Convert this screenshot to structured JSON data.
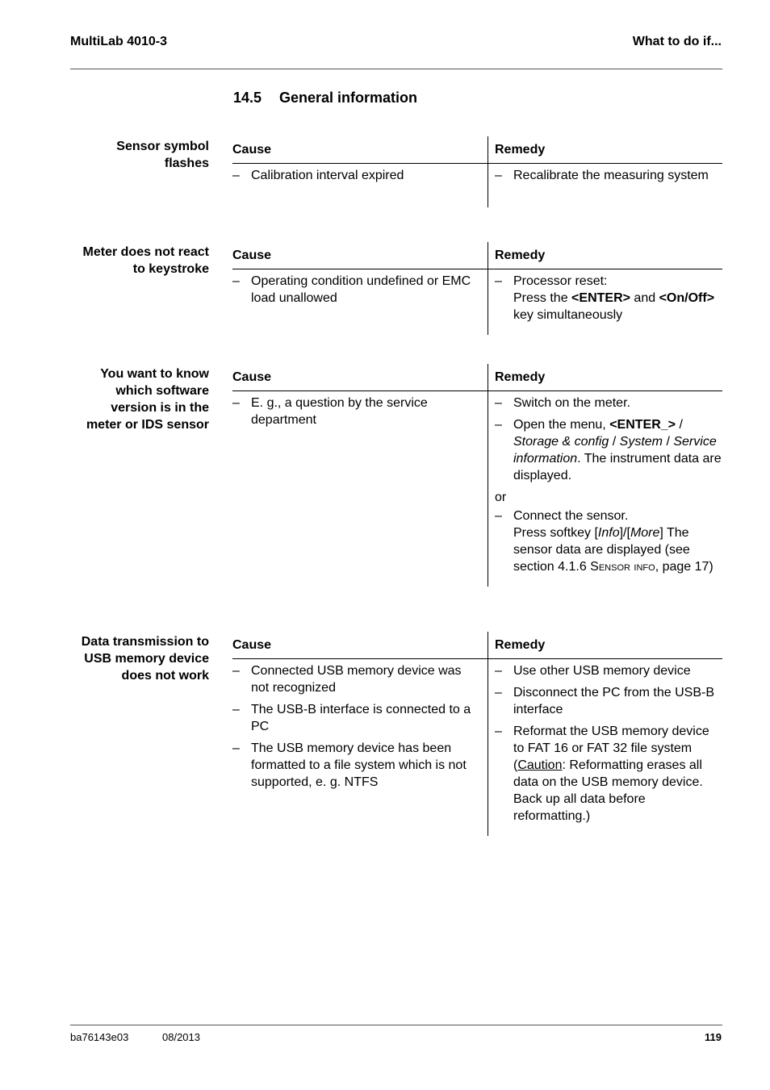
{
  "header": {
    "left": "MultiLab 4010-3",
    "right": "What to do if..."
  },
  "section": {
    "number": "14.5",
    "title": "General information"
  },
  "columns": {
    "cause": "Cause",
    "remedy": "Remedy"
  },
  "blocks": [
    {
      "label_lines": [
        "Sensor symbol",
        "flashes"
      ],
      "causes": [
        "Calibration interval expired"
      ],
      "remedies": [
        "Recalibrate the measuring system"
      ]
    },
    {
      "label_lines": [
        "Meter does not react",
        "to keystroke"
      ],
      "causes": [
        "Operating condition undefined or EMC load unallowed"
      ],
      "remedies": {
        "line1": "Processor reset:",
        "press_the": "Press the",
        "key_enter": "<ENTER>",
        "and": "and",
        "key_onoff": "<On/Off>",
        "tail": "key simultaneously"
      }
    },
    {
      "label_lines": [
        "You want to know",
        "which software",
        "version is in the",
        "meter or IDS sensor"
      ],
      "causes": [
        "E. g., a question by the service department"
      ],
      "remedies": {
        "r1": "Switch on the meter.",
        "r2_pre": "Open the menu,",
        "r2_key": "<ENTER_>",
        "r2_sep": "/",
        "r2_menu1": "Storage & config",
        "r2_menu2": "System",
        "r2_menu3": "Service information",
        "r2_tail": ". The instrument data are displayed.",
        "or": "or",
        "r3_line1": "Connect the sensor.",
        "r3_pre": "Press softkey [",
        "r3_soft1": "Info",
        "r3_mid": "]/[",
        "r3_soft2": "More",
        "r3_post": "] The sensor data are displayed (see section 4.1.6 ",
        "r3_ref": "Sensor info",
        "r3_end": ", page 17)"
      }
    },
    {
      "label_lines": [
        "Data transmission to",
        "USB memory device",
        "does not work"
      ],
      "causes": [
        "Connected USB memory device was not recognized",
        "The USB-B interface is connected to a PC",
        "The USB memory device has been formatted to a file system which is not supported, e. g. NTFS"
      ],
      "remedies": {
        "r1": "Use other USB memory device",
        "r2": "Disconnect the PC from the USB-B interface",
        "r3": "Reformat the USB memory device to FAT 16 or FAT 32 file system",
        "caution_label": "Caution",
        "caution_text": ": Reformatting erases all data on the USB memory device. Back up all data before reformatting.)"
      }
    }
  ],
  "dash": "–",
  "footer": {
    "doc_id": "ba76143e03",
    "date": "08/2013",
    "page": "119"
  }
}
